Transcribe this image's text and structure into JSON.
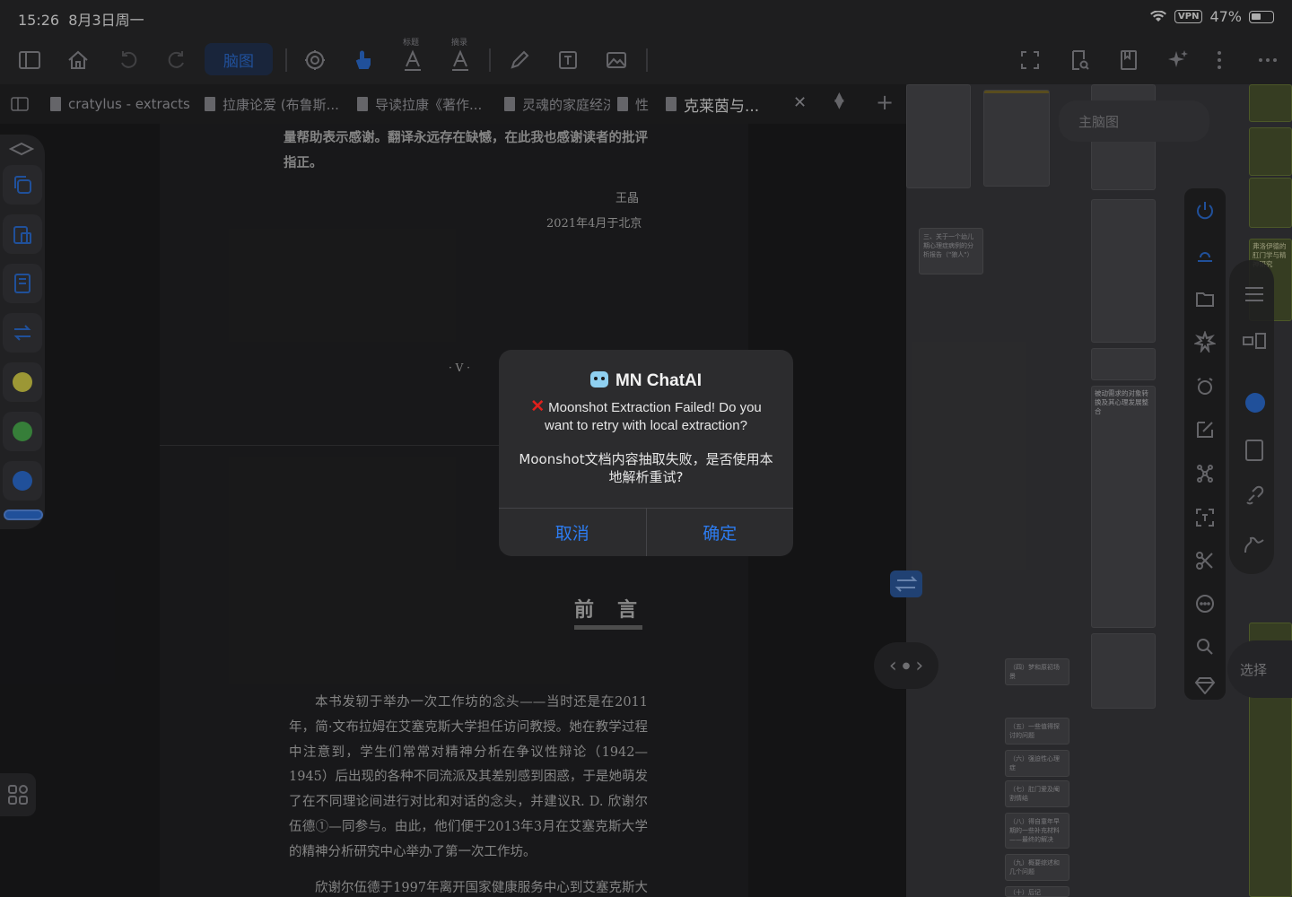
{
  "status_bar": {
    "time": "15:26",
    "date": "8月3日周一",
    "vpn": "VPN",
    "battery": "47%"
  },
  "toolbar": {
    "mindmap_label": "脑图",
    "heading_label": "标题",
    "excerpt_label": "摘录"
  },
  "tabs": [
    {
      "label": "cratylus - extracts"
    },
    {
      "label": "拉康论爱 (布鲁斯..."
    },
    {
      "label": "导读拉康《著作..."
    },
    {
      "label": "灵魂的家庭经济"
    },
    {
      "label": "性"
    },
    {
      "label": "克莱茵与..."
    }
  ],
  "document": {
    "line1": "量帮助表示感谢。翻译永远存在缺憾，在此我也感谢读者的批评",
    "line2": "指正。",
    "signature": "王晶",
    "date_line": "2021年4月于北京",
    "page_numeral": "· V ·",
    "preface_title": "前言",
    "paragraph1": "本书发轫于举办一次工作坊的念头——当时还是在2011年，简·文布拉姆在艾塞克斯大学担任访问教授。她在教学过程中注意到，学生们常常对精神分析在争议性辩论（1942—1945）后出现的各种不同流派及其差别感到困惑，于是她萌发了在不同理论间进行对比和对话的念头，并建议R. D. 欣谢尔伍德①—同参与。由此，他们便于2013年3月在艾塞克斯大学的精神分析研究中心举办了第一次工作坊。",
    "paragraph2_start": "欣谢尔伍德于1997年离开国家健康服务中心到艾塞克斯大学"
  },
  "mindmap": {
    "title": "主脑图",
    "nodes": [
      {
        "label": "三、关于一个幼儿期心理症病例的分析报告（\"狼人\"）"
      },
      {
        "label": "（四）梦和原初场景"
      },
      {
        "label": "（五）一些值得探讨的问题"
      },
      {
        "label": "（六）强迫性心理症"
      },
      {
        "label": "（七）肛门爱及阉割情结"
      },
      {
        "label": "（八）得自童年早期的一些补充材料——最终的解决"
      },
      {
        "label": "（九）概要综述和几个问题"
      },
      {
        "label": "（十）后记"
      }
    ],
    "card_header": "被动需求的对象转换及其心理发展整合",
    "right_header": "弗洛伊德的肛门学与精神研究",
    "select_label": "选择"
  },
  "dialog": {
    "title": "MN ChatAI",
    "message_en": "Moonshot Extraction Failed! Do you want to retry with local extraction?",
    "message_zh": "Moonshot文档内容抽取失败，是否使用本地解析重试?",
    "cancel": "取消",
    "confirm": "确定"
  },
  "colors": {
    "accent": "#2d7cf0",
    "error": "#e0201c",
    "dot_yellow": "#d8d24a",
    "dot_green": "#4caf50",
    "dot_blue": "#2d6fd6"
  },
  "icons": [
    "sidebar-icon",
    "home-icon",
    "undo-icon",
    "redo-icon",
    "settings-gear-icon",
    "hand-pointer-icon",
    "heading-a-icon",
    "excerpt-a-icon",
    "pen-icon",
    "textbox-icon",
    "image-icon",
    "fullscreen-icon",
    "search-doc-icon",
    "bookmark-icon",
    "sparkle-icon",
    "more-icon"
  ]
}
